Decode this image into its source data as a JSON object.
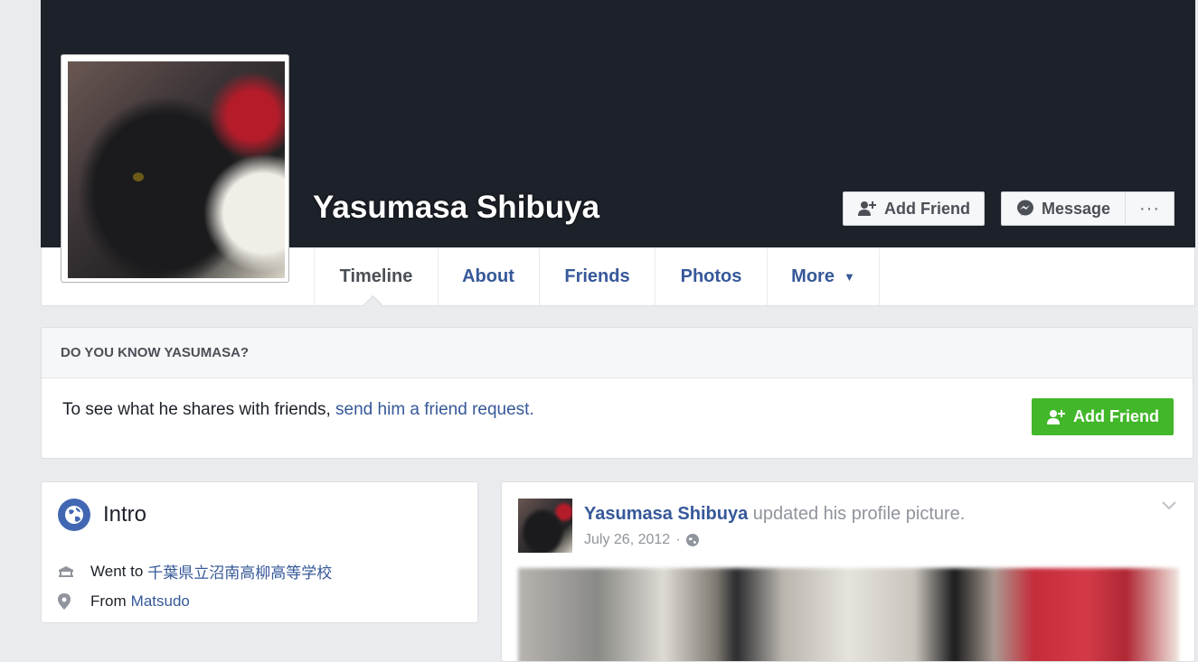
{
  "profile": {
    "name": "Yasumasa Shibuya"
  },
  "cover_actions": {
    "add_friend_label": "Add Friend",
    "message_label": "Message",
    "more_label": "···"
  },
  "tabs": [
    {
      "label": "Timeline",
      "active": true
    },
    {
      "label": "About"
    },
    {
      "label": "Friends"
    },
    {
      "label": "Photos"
    },
    {
      "label": "More",
      "caret": "▼"
    }
  ],
  "know_card": {
    "heading": "DO YOU KNOW YASUMASA?",
    "text": "To see what he shares with friends,",
    "link": "send him a friend request.",
    "button_label": "Add Friend"
  },
  "intro": {
    "title": "Intro",
    "went_to_prefix": "Went to",
    "school": "千葉県立沼南高柳高等学校",
    "from_prefix": "From",
    "hometown": "Matsudo"
  },
  "post": {
    "author": "Yasumasa Shibuya",
    "action": "updated his profile picture.",
    "date": "July 26, 2012",
    "separator": "·"
  },
  "colors": {
    "link": "#365899",
    "green": "#42b72a",
    "cover": "#1d2129",
    "page_bg": "#e9ebee"
  },
  "icons": {
    "intro": "globe-icon",
    "school": "school-icon",
    "from": "location-pin-icon",
    "privacy": "public-globe-icon",
    "message": "messenger-icon",
    "add_friend": "add-friend-icon"
  }
}
